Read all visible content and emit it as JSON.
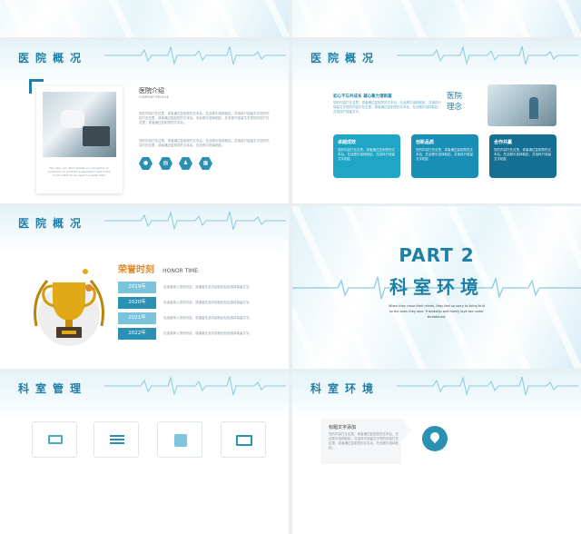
{
  "s1": {},
  "s2": {},
  "s3": {
    "title": "医院概况",
    "heading": "医院介绍",
    "subheading": "COMPANY PROFILE",
    "caption": "The user can demonstrate on a projector or computer, or print the presentation and make it into a film to be used in a wider field",
    "para1": "您的内容打在这里，或者通过复制您的文本后，在此框中选择粘贴，并选择只保留文字您的内容打在这里，或者通过复制您的文本后，在此框中选择粘贴，并选择只保留文字您的内容打在这里，或者通过复制您的文本后。",
    "para2": "您的内容打在这里，或者通过复制您的文本后，在此框中选择粘贴，并选择只保留文字您的内容打在这里，或者通过复制您的文本后，在此框中选择粘贴。",
    "icons": [
      "people-icon",
      "chart-icon",
      "user-icon",
      "calendar-icon"
    ]
  },
  "s4": {
    "title": "医院概况",
    "vertical_title_1": "医院",
    "vertical_title_2": "理念",
    "slogan": "初心不忘共成长 凝心聚力谱新篇",
    "para": "您的内容打在这里，或者通过复制您的文本后，在此框中选择粘贴，并选择只保留文字您的内容打在这里，或者通过复制您的文本后，在此框中选择粘贴，并选择只保留文字。",
    "cards": [
      {
        "title": "卓越成效",
        "text": "您的内容打在这里，或者通过复制您的文本后，在此框中选择粘贴，并选择只保留文字粘贴",
        "color": "#1fa6c6"
      },
      {
        "title": "创新品质",
        "text": "您的内容打在这里，或者通过复制您的文本后，在此框中选择粘贴，并选择只保留文字粘贴",
        "color": "#1a8fb6"
      },
      {
        "title": "合作共赢",
        "text": "您的内容打在这里，或者通过复制您的文本后，在此框中选择粘贴，并选择只保留文字粘贴",
        "color": "#156f92"
      }
    ]
  },
  "s5": {
    "title": "医院概况",
    "honor_cn": "荣誉时刻",
    "honor_en": "HONOR TIME",
    "years": [
      "2019年",
      "2020年",
      "2021年",
      "2022年"
    ],
    "desc": "包适量简入您的内容，或通量在此内容粘贴包括选择保留文字。",
    "year_colors": [
      "#79c4da",
      "#2a91b4",
      "#79c4da",
      "#2a91b4"
    ]
  },
  "s6": {
    "part": "PART 2",
    "title": "科室环境",
    "sub1": "When they close their minds, they feel so sorry to bring fruit",
    "sub2": "to the ones they love. Friendship and family love are under",
    "sub3": "threatened."
  },
  "s7": {
    "title": "科室管理",
    "icons": [
      "laptop-icon",
      "list-icon",
      "edit-icon",
      "image-icon"
    ]
  },
  "s8": {
    "title": "科室环境",
    "label": "标题文字添加",
    "text": "您的内容打在这里，或者通过复制您的文本后，在此框中选择粘贴，并选择只保留文字您的内容打在这里，或者通过复制您的文本后，在此框中选择粘贴。"
  }
}
